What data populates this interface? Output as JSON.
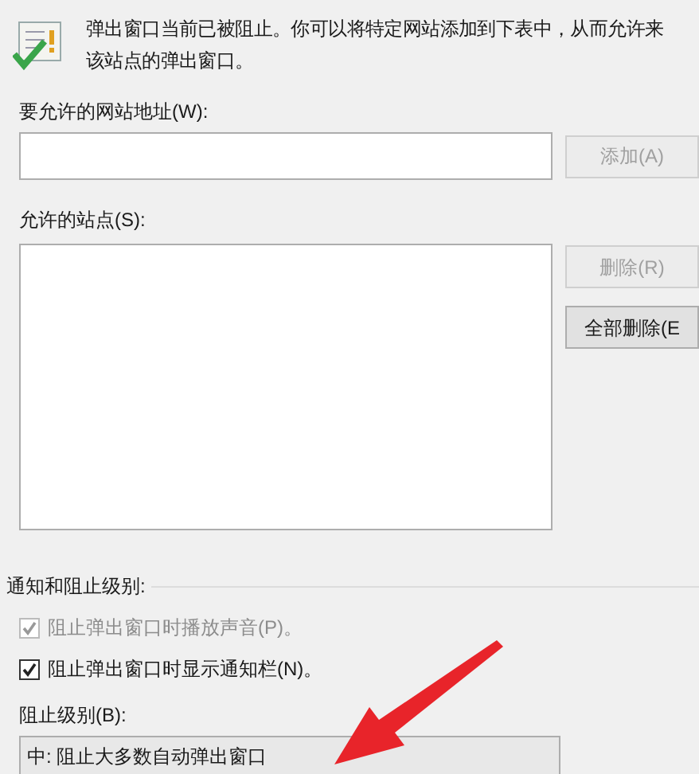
{
  "intro": {
    "lines": [
      "弹出窗口当前已被阻止。你可以将特定网站添加到下表中，从而允许来",
      "该站点的弹出窗口。"
    ]
  },
  "address": {
    "label": "要允许的网站地址(W):",
    "add_button": {
      "label": "添加(A)",
      "disabled": true
    }
  },
  "allowed_sites": {
    "label": "允许的站点(S):",
    "buttons": [
      {
        "label": "删除(R)",
        "disabled": true
      },
      {
        "label": "全部删除(E",
        "disabled": false
      }
    ]
  },
  "notification": {
    "heading": "通知和阻止级别:",
    "options": [
      {
        "label": "阻止弹出窗口时播放声音(P)。",
        "checked": true,
        "disabled": true
      },
      {
        "label": "阻止弹出窗口时显示通知栏(N)。",
        "checked": true,
        "disabled": false
      }
    ]
  },
  "blocking_level": {
    "label": "阻止级别(B):",
    "value": "中: 阻止大多数自动弹出窗口"
  }
}
